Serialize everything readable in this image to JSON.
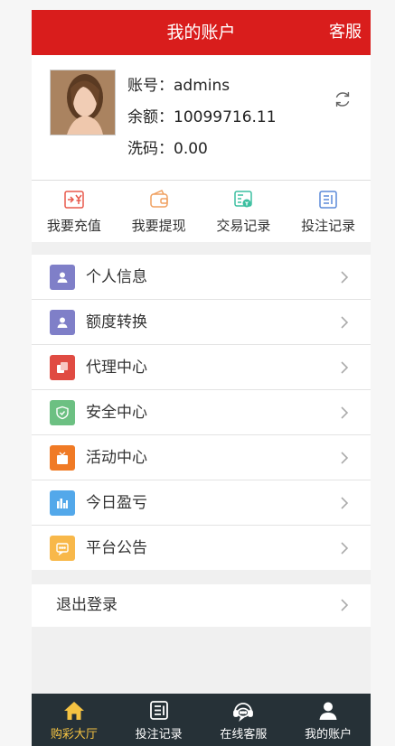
{
  "header": {
    "title": "我的账户",
    "service": "客服"
  },
  "account": {
    "account_label": "账号：",
    "account_value": "admins",
    "balance_label": "余额：",
    "balance_value": "10099716.11",
    "wash_label": "洗码：",
    "wash_value": "0.00"
  },
  "quick": [
    {
      "label": "我要充值",
      "icon": "recharge-icon",
      "color": "#e8594b"
    },
    {
      "label": "我要提现",
      "icon": "wallet-icon",
      "color": "#f0a060"
    },
    {
      "label": "交易记录",
      "icon": "transaction-icon",
      "color": "#3cbfa0"
    },
    {
      "label": "投注记录",
      "icon": "bet-record-icon",
      "color": "#5b8ad9"
    }
  ],
  "menu": [
    {
      "label": "个人信息",
      "icon": "user-icon",
      "color": "#7f7fc8"
    },
    {
      "label": "额度转换",
      "icon": "user-icon",
      "color": "#7f7fc8"
    },
    {
      "label": "代理中心",
      "icon": "agent-icon",
      "color": "#e04b42"
    },
    {
      "label": "安全中心",
      "icon": "shield-icon",
      "color": "#6cc082"
    },
    {
      "label": "活动中心",
      "icon": "gift-icon",
      "color": "#f07a25"
    },
    {
      "label": "今日盈亏",
      "icon": "chart-icon",
      "color": "#53a8ea"
    },
    {
      "label": "平台公告",
      "icon": "message-icon",
      "color": "#f8b84a"
    }
  ],
  "logout": "退出登录",
  "tabs": [
    {
      "label": "购彩大厅",
      "icon": "home-icon",
      "active": true
    },
    {
      "label": "投注记录",
      "icon": "list-icon",
      "active": false
    },
    {
      "label": "在线客服",
      "icon": "support-icon",
      "active": false
    },
    {
      "label": "我的账户",
      "icon": "person-icon",
      "active": false
    }
  ],
  "colors": {
    "brand": "#d91d1c",
    "tabbar": "#263137",
    "tab_active": "#f5c342"
  }
}
